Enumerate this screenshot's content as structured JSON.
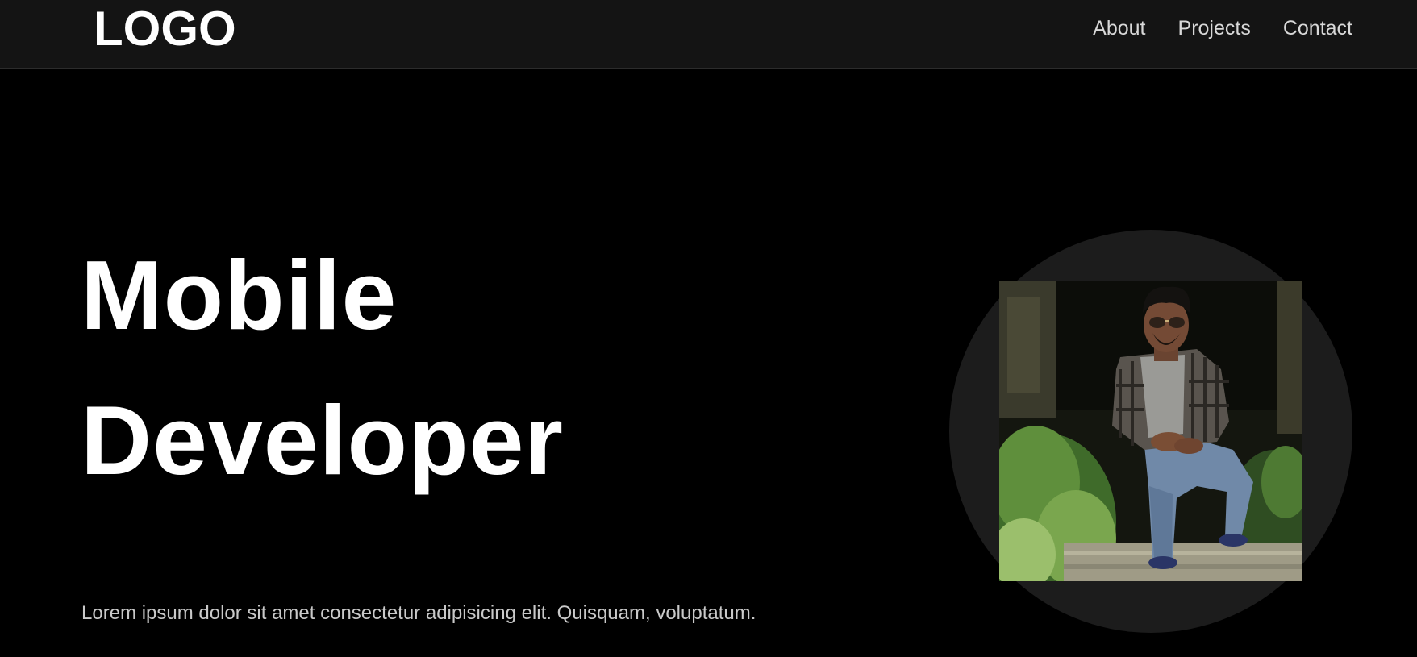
{
  "header": {
    "logo": "LOGO",
    "nav": [
      {
        "label": "About"
      },
      {
        "label": "Projects"
      },
      {
        "label": "Contact"
      }
    ]
  },
  "hero": {
    "headline_line1": "Mobile",
    "headline_line2": "Developer",
    "subtitle": "Lorem ipsum dolor sit amet consectetur adipisicing elit. Quisquam, voluptatum."
  },
  "colors": {
    "background": "#000000",
    "navbar": "#141414",
    "circle": "#1c1c1c",
    "text": "#ffffff",
    "muted_text": "#c9c9c9"
  }
}
